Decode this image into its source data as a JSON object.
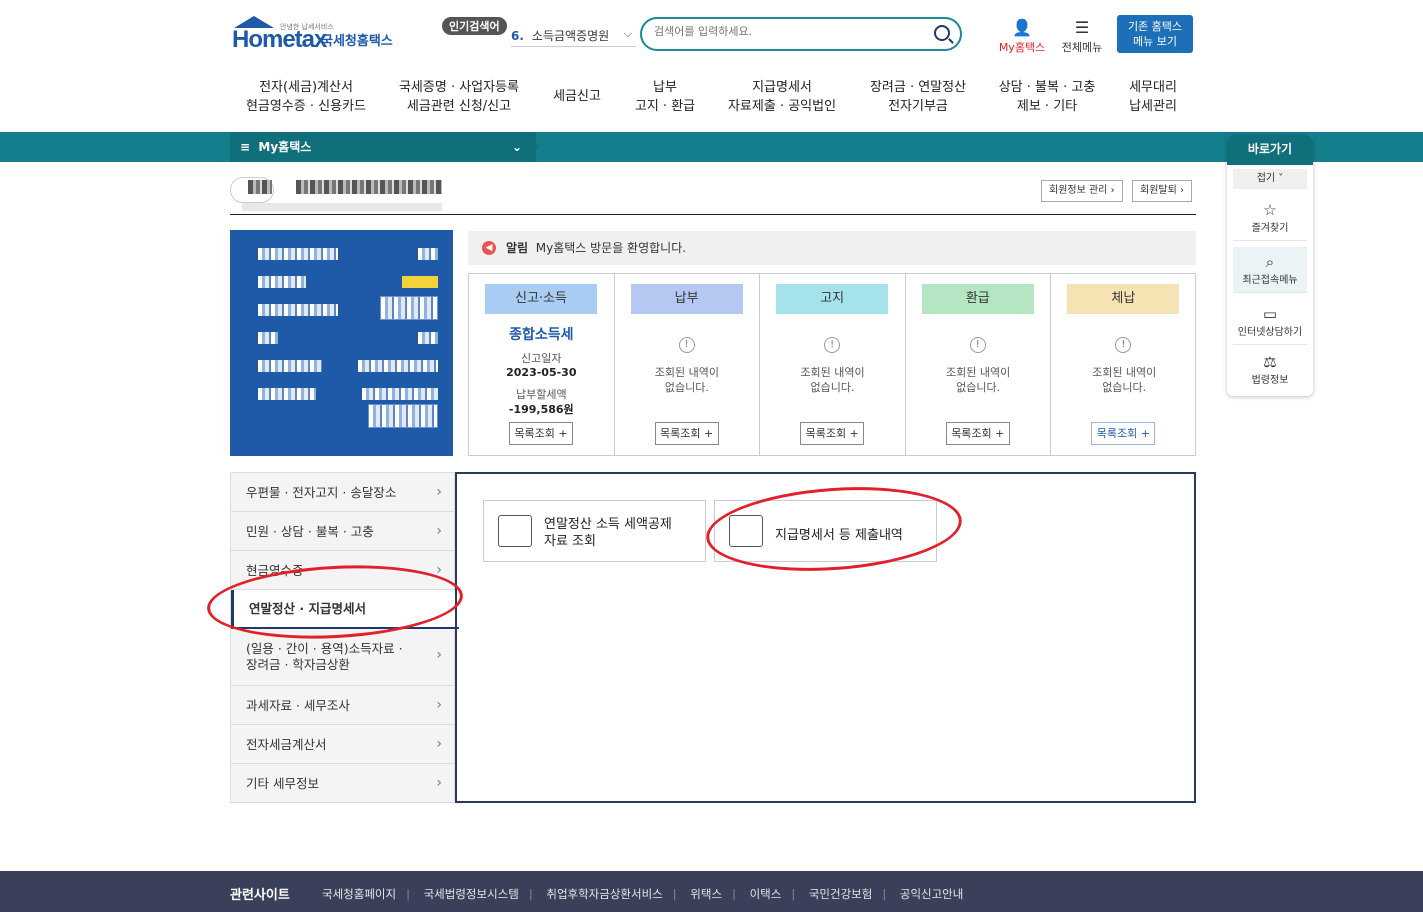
{
  "header": {
    "logo_main": "Hometax",
    "logo_small": "안녕한 납세서비스",
    "logo_kr": "국세청홈택스",
    "popular_label": "인기검색어",
    "popular_rank": "6.",
    "popular_term": "소득금액증명원",
    "search_placeholder": "검색어를 입력하세요.",
    "my_hometax": "My홈택스",
    "all_menu": "전체메뉴",
    "old_hometax_line1": "기존 홈택스",
    "old_hometax_line2": "메뉴 보기"
  },
  "gnb": [
    {
      "l1": "전자(세금)계산서",
      "l2": "현금영수증 · 신용카드"
    },
    {
      "l1": "국세증명 · 사업자등록",
      "l2": "세금관련 신청/신고"
    },
    {
      "l1": "세금신고",
      "l2": ""
    },
    {
      "l1": "납부",
      "l2": "고지 · 환급"
    },
    {
      "l1": "지급명세서",
      "l2": "자료제출 · 공익법인"
    },
    {
      "l1": "장려금 · 연말정산",
      "l2": "전자기부금"
    },
    {
      "l1": "상담 · 불복 · 고충",
      "l2": "제보 · 기타"
    },
    {
      "l1": "세무대리",
      "l2": "납세관리"
    }
  ],
  "location_bar": {
    "label": "My홈택스"
  },
  "profile": {
    "manage_btn": "회원정보 관리",
    "withdraw_btn": "회원탈퇴"
  },
  "notice": {
    "label": "알림",
    "text": "My홈택스 방문을 환영합니다."
  },
  "cards": [
    {
      "title": "신고·소득",
      "color": "#a9cdf2",
      "emph": "종합소득세",
      "date_label": "신고일자",
      "date": "2023-05-30",
      "amount_label": "납부할세액",
      "amount": "-199,586원",
      "btn": "목록조회 +"
    },
    {
      "title": "납부",
      "color": "#b4c8f2",
      "msg1": "조회된 내역이",
      "msg2": "없습니다.",
      "btn": "목록조회 +"
    },
    {
      "title": "고지",
      "color": "#a6e2ec",
      "msg1": "조회된 내역이",
      "msg2": "없습니다.",
      "btn": "목록조회 +"
    },
    {
      "title": "환급",
      "color": "#b4e6c4",
      "msg1": "조회된 내역이",
      "msg2": "없습니다.",
      "btn": "목록조회 +"
    },
    {
      "title": "체납",
      "color": "#f6e3b4",
      "msg1": "조회된 내역이",
      "msg2": "없습니다.",
      "btn": "목록조회 +"
    }
  ],
  "sidemenu": [
    {
      "l1": "우편물 · 전자고지 · 송달장소"
    },
    {
      "l1": "민원 · 상담 · 불복 · 고충"
    },
    {
      "l1": "현금영수증"
    },
    {
      "l1": "연말정산 · 지급명세서"
    },
    {
      "l1": "(일용 · 간이 · 용역)소득자료 ·",
      "l2": "장려금 · 학자금상환"
    },
    {
      "l1": "과세자료 · 세무조사"
    },
    {
      "l1": "전자세금계산서"
    },
    {
      "l1": "기타 세무정보"
    }
  ],
  "tiles": [
    {
      "l1": "연말정산 소득 세액공제",
      "l2": "자료 조회"
    },
    {
      "l1": "지급명세서 등 제출내역",
      "l2": ""
    }
  ],
  "quick": {
    "title": "바로가기",
    "fold": "접기 ˅",
    "items": [
      "즐겨찾기",
      "최근접속메뉴",
      "인터넷상담하기",
      "법령정보"
    ]
  },
  "footer": {
    "title": "관련사이트",
    "links": [
      "국세청홈페이지",
      "국세법령정보시스템",
      "취업후학자금상환서비스",
      "위택스",
      "이택스",
      "국민건강보험",
      "공익신고안내"
    ]
  }
}
